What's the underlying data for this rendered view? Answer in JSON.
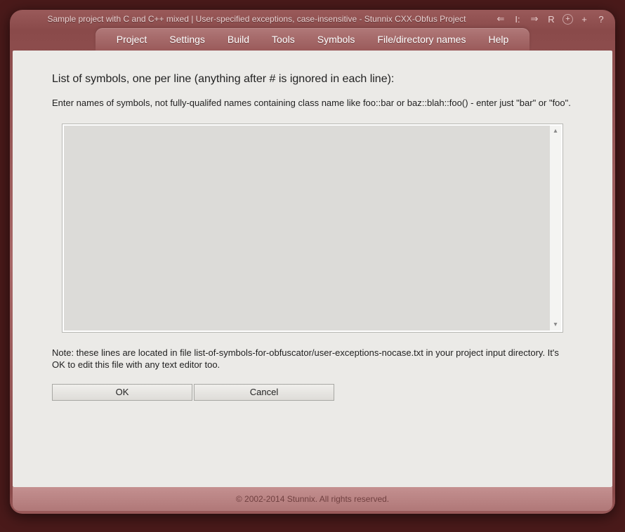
{
  "title": "Sample project with C and C++ mixed | User-specified exceptions, case-insensitive - Stunnix CXX-Obfus Project",
  "title_icons": {
    "back": "⇐",
    "stop": "I:",
    "forward": "⇒",
    "reload": "R",
    "zoom_in": "+",
    "add": "+",
    "help": "?"
  },
  "menu": {
    "items": [
      {
        "label": "Project"
      },
      {
        "label": "Settings"
      },
      {
        "label": "Build"
      },
      {
        "label": "Tools"
      },
      {
        "label": "Symbols"
      },
      {
        "label": "File/directory names"
      },
      {
        "label": "Help"
      }
    ]
  },
  "content": {
    "heading": "List of symbols, one per line (anything after # is ignored in each line):",
    "instruction": "Enter names of symbols, not fully-qualifed names containing class name like foo::bar or baz::blah::foo() - enter just \"bar\" or \"foo\".",
    "textarea_value": "",
    "note": "Note: these lines are located in file list-of-symbols-for-obfuscator/user-exceptions-nocase.txt in your project input directory. It's OK to edit this file with any text editor too.",
    "buttons": {
      "ok": "OK",
      "cancel": "Cancel"
    }
  },
  "footer": "© 2002-2014 Stunnix. All rights reserved."
}
